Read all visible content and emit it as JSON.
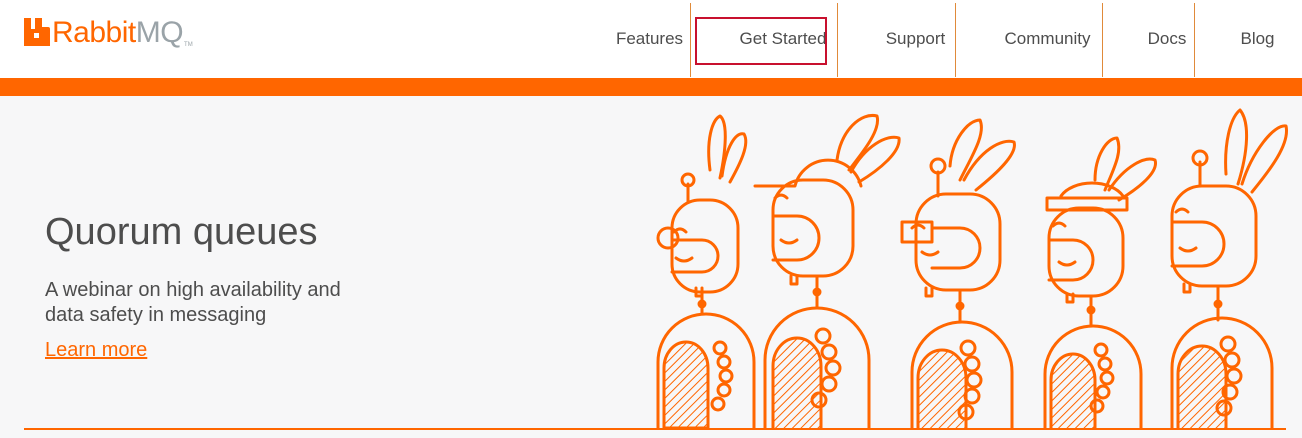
{
  "brand": {
    "name_part1": "Rabbit",
    "name_part2": "MQ",
    "trademark": "TM",
    "logo_icon": "rabbitmq-logo-icon"
  },
  "nav": {
    "items": [
      {
        "label": "Features",
        "active": false
      },
      {
        "label": "Get Started",
        "active": true
      },
      {
        "label": "Support",
        "active": false
      },
      {
        "label": "Community",
        "active": false
      },
      {
        "label": "Docs",
        "active": false
      },
      {
        "label": "Blog",
        "active": false
      }
    ]
  },
  "hero": {
    "title": "Quorum queues",
    "subtitle": "A webinar on high availability and data safety in messaging",
    "link_label": "Learn more",
    "illustration": "robot-rabbits-illustration"
  },
  "colors": {
    "accent": "#ff6600",
    "text": "#4d4d4d",
    "logo_grey": "#9aa3a8",
    "active_outline": "#c8102e",
    "hero_bg": "#f7f7f8"
  }
}
